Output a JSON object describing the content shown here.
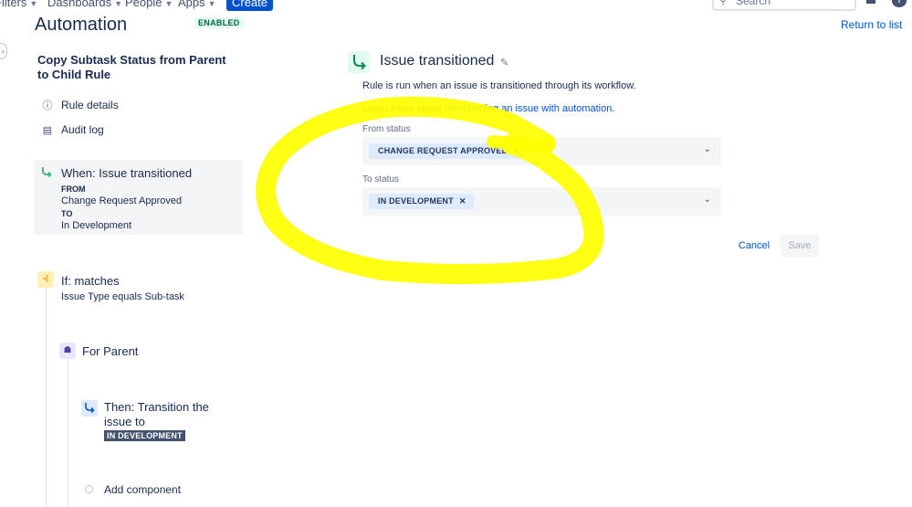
{
  "nav": {
    "filters": "Filters",
    "dashboards": "Dashboards",
    "people": "People",
    "apps": "Apps",
    "create": "Create",
    "search_placeholder": "Search",
    "help": "?"
  },
  "header": {
    "title": "Automation",
    "status": "ENABLED",
    "return_link": "Return to list"
  },
  "sidebar": {
    "rule_name": "Copy Subtask Status from Parent to Child Rule",
    "links": [
      {
        "label": "Rule details",
        "icon": "info-icon"
      },
      {
        "label": "Audit log",
        "icon": "document-icon"
      }
    ],
    "trigger": {
      "title": "When: Issue transitioned",
      "from_label": "FROM",
      "from_value": "Change Request Approved",
      "to_label": "TO",
      "to_value": "In Development"
    },
    "condition": {
      "title": "If: matches",
      "detail": "Issue Type equals Sub-task"
    },
    "branch": {
      "title": "For Parent"
    },
    "action": {
      "title_line1": "Then: Transition the",
      "title_line2": "issue to",
      "status": "IN DEVELOPMENT"
    },
    "add_component": "Add component"
  },
  "main": {
    "title": "Issue transitioned",
    "description": "Rule is run when an issue is transitioned through its workflow.",
    "learn_prefix": "Learn more about ",
    "learn_link": "transitioning an issue with automation.",
    "from_label": "From status",
    "from_value": "CHANGE REQUEST APPROVED",
    "to_label": "To status",
    "to_value": "IN DEVELOPMENT",
    "cancel": "Cancel",
    "save": "Save"
  },
  "colors": {
    "brand": "#0052cc",
    "highlight": "#ffff00",
    "chip_bg": "#deebff",
    "enabled_bg": "#e3fcef"
  }
}
